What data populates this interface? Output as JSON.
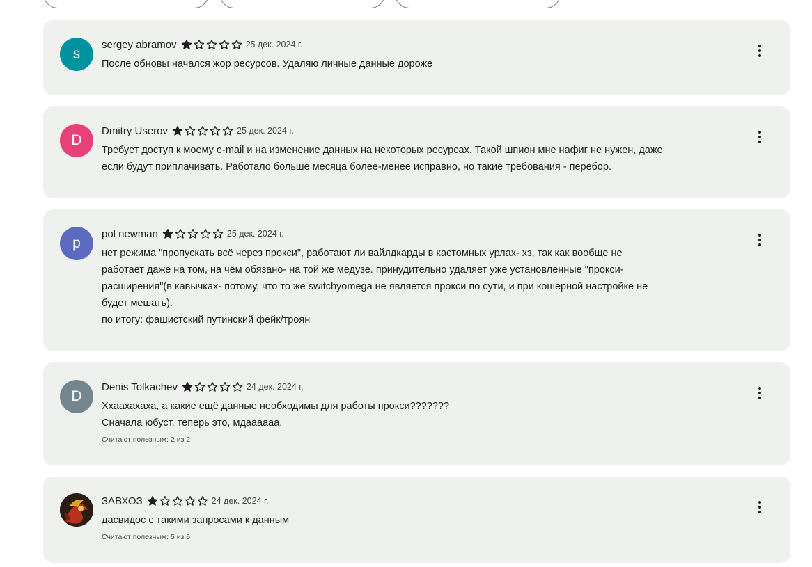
{
  "colors": {
    "card_background": "#eff1ef",
    "star": "#1f1f1f",
    "avatar_s": "#00939f",
    "avatar_d_pink": "#e8417a",
    "avatar_p": "#5c6bc0",
    "avatar_d_gray": "#75858e"
  },
  "reviews": [
    {
      "author": "sergey abramov",
      "initial": "s",
      "avatar_color": "#00939f",
      "rating": 1,
      "max_rating": 5,
      "date": "25 дек. 2024 г.",
      "text": "После обновы начался жор ресурсов.  Удаляю личные данные дороже",
      "helpful": "",
      "menu_icon": "more-vert-icon"
    },
    {
      "author": "Dmitry Userov",
      "initial": "D",
      "avatar_color": "#e8417a",
      "rating": 1,
      "max_rating": 5,
      "date": "25 дек. 2024 г.",
      "text": "Требует доступ к моему e-mail и на изменение данных на некоторых ресурсах. Такой шпион мне нафиг не нужен, даже\nесли будут приплачивать. Работало больше месяца более-менее исправно, но такие требования - перебор.",
      "helpful": "",
      "menu_icon": "more-vert-icon"
    },
    {
      "author": "pol newman",
      "initial": "p",
      "avatar_color": "#5c6bc0",
      "rating": 1,
      "max_rating": 5,
      "date": "25 дек. 2024 г.",
      "text": "нет режима \"пропускать всё через прокси\", работают ли вайлдкарды  в кастомных урлах- хз, так как вообще не\nработает даже на том, на чём обязано- на той же медузе. принудительно удаляет уже установленные \"прокси-\nрасширения\"(в кавычках- потому, что то же switchyomega не является прокси по сути, и при кошерной настройке не\nбудет мешать).\nпо итогу: фашистский путинский фейк/троян",
      "helpful": "",
      "menu_icon": "more-vert-icon"
    },
    {
      "author": "Denis Tolkachev",
      "initial": "D",
      "avatar_color": "#75858e",
      "rating": 1,
      "max_rating": 5,
      "date": "24 дек. 2024 г.",
      "text": "Ххаахахаха, а какие ещё данные необходимы для работы прокси???????\nСначала юбуст, теперь это, мдаааааа.",
      "helpful": "Считают полезным: 2 из 2",
      "menu_icon": "more-vert-icon"
    },
    {
      "author": "ЗАВХОЗ",
      "initial": "",
      "avatar_color": "#2b1d14",
      "rating": 1,
      "max_rating": 5,
      "date": "24 дек. 2024 г.",
      "text": "дасвидос с такими запросами к данным",
      "helpful": "Считают полезным: 5 из 6",
      "menu_icon": "more-vert-icon"
    }
  ]
}
